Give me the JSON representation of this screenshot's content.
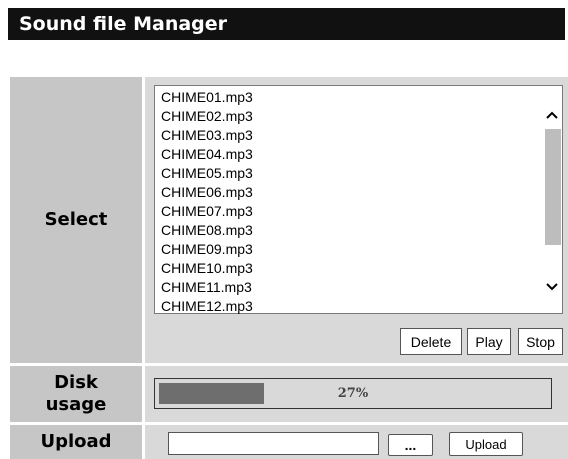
{
  "window": {
    "title": "Sound file Manager"
  },
  "select": {
    "label": "Select",
    "files": [
      "CHIME01.mp3",
      "CHIME02.mp3",
      "CHIME03.mp3",
      "CHIME04.mp3",
      "CHIME05.mp3",
      "CHIME06.mp3",
      "CHIME07.mp3",
      "CHIME08.mp3",
      "CHIME09.mp3",
      "CHIME10.mp3",
      "CHIME11.mp3",
      "CHIME12.mp3"
    ],
    "buttons": {
      "delete": "Delete",
      "play": "Play",
      "stop": "Stop"
    }
  },
  "disk": {
    "label_line1": "Disk",
    "label_line2": "usage",
    "usage_fraction": 0.27,
    "usage_text": "27%"
  },
  "upload": {
    "label": "Upload",
    "file_value": "",
    "browse_label": "...",
    "upload_label": "Upload"
  },
  "colors": {
    "title_bg": "#111111",
    "label_bg": "#c6c6c6",
    "content_bg": "#d9d9d9",
    "usage_fill": "#6e6e6e"
  },
  "icons": {
    "scroll_up": "chevron-up-icon",
    "scroll_down": "chevron-down-icon"
  }
}
